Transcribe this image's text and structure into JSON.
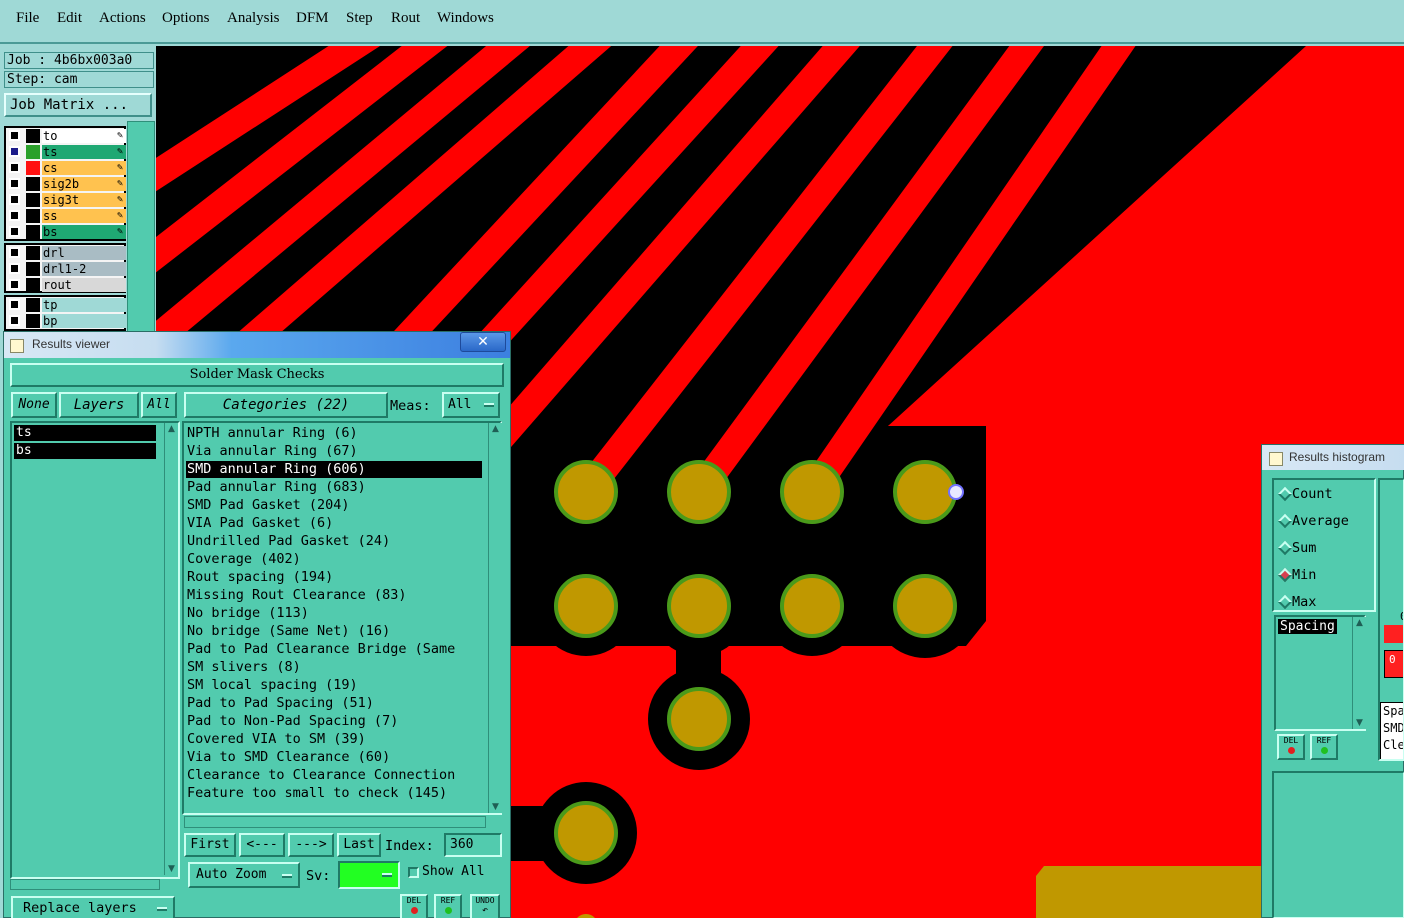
{
  "menu": [
    "File",
    "Edit",
    "Actions",
    "Options",
    "Analysis",
    "DFM",
    "Step",
    "Rout",
    "Windows"
  ],
  "job": {
    "job_line": "Job : 4b6bx003a0",
    "step_line": "Step: cam",
    "matrix_button": "Job Matrix ..."
  },
  "layers": {
    "group1": [
      {
        "name": "to",
        "color": "#ffffff",
        "swatch": "#000000",
        "checked_color": "#000000"
      },
      {
        "name": "ts",
        "color": "#1fa873",
        "swatch": "#2aa02a",
        "checked_color": "#1c1c8a"
      },
      {
        "name": "cs",
        "color": "#ffc24f",
        "swatch": "#ff1010",
        "checked_color": "#000000"
      },
      {
        "name": "sig2b",
        "color": "#ffc24f",
        "swatch": "#000000",
        "checked_color": "#000000"
      },
      {
        "name": "sig3t",
        "color": "#ffc24f",
        "swatch": "#000000",
        "checked_color": "#000000"
      },
      {
        "name": "ss",
        "color": "#ffc24f",
        "swatch": "#000000",
        "checked_color": "#000000"
      },
      {
        "name": "bs",
        "color": "#1fa873",
        "swatch": "#000000",
        "checked_color": "#000000"
      }
    ],
    "group2": [
      {
        "name": "drl",
        "color": "#a9bcc4"
      },
      {
        "name": "drl1-2",
        "color": "#a9bcc4"
      },
      {
        "name": "rout",
        "color": "#d8d8d8"
      }
    ],
    "group3": [
      {
        "name": "tp",
        "color": "#9fd9d6"
      },
      {
        "name": "bp",
        "color": "#9fd9d6"
      }
    ]
  },
  "results_viewer": {
    "title": "Results viewer",
    "close_glyph": "✕",
    "check_name": "Solder Mask Checks",
    "none_label": "None",
    "layers_label": "Layers",
    "all_label": "All",
    "categories_label": "Categories (22)",
    "meas_label": "Meas:",
    "meas_value": "All",
    "layer_items": [
      "ts",
      "bs"
    ],
    "categories": [
      "NPTH annular Ring (6)",
      "Via annular Ring (67)",
      "SMD annular Ring (606)",
      "Pad annular Ring (683)",
      "SMD Pad Gasket (204)",
      "VIA Pad Gasket (6)",
      "Undrilled Pad Gasket (24)",
      "Coverage (402)",
      "Rout spacing (194)",
      "Missing Rout Clearance (83)",
      "No bridge (113)",
      "No bridge (Same Net) (16)",
      "Pad to Pad Clearance Bridge (Same",
      "SM slivers (8)",
      "SM local spacing (19)",
      "Pad to Pad Spacing (51)",
      "Pad to Non-Pad Spacing (7)",
      "Covered VIA to SM (39)",
      "Via to SMD Clearance (60)",
      "Clearance to Clearance Connection",
      "Feature too small to check (145)"
    ],
    "selected_index": 2,
    "nav": {
      "first": "First",
      "prev": "<---",
      "next": "--->",
      "last": "Last",
      "index_label": "Index:",
      "index_value": "360"
    },
    "zoom_label": "Auto Zoom",
    "sv_label": "Sv:",
    "show_all_label": "Show All",
    "replace_label": "Replace layers",
    "del_label": "DEL",
    "ref_label": "REF",
    "undo_label": "UNDO"
  },
  "histogram": {
    "title": "Results histogram",
    "options": [
      "Count",
      "Average",
      "Sum",
      "Min",
      "Max"
    ],
    "selected_option": "Min",
    "list_item": "Spacing",
    "del_label": "DEL",
    "ref_label": "REF",
    "right_texts": [
      "Spa",
      "SMD",
      "Cle"
    ],
    "values": [
      "0",
      "0"
    ]
  },
  "colors": {
    "board_red": "#ff0000",
    "mask_black": "#000000",
    "pad_gold": "#c09800",
    "pad_ring": "#4a9a1a",
    "panel": "#52cbae"
  }
}
